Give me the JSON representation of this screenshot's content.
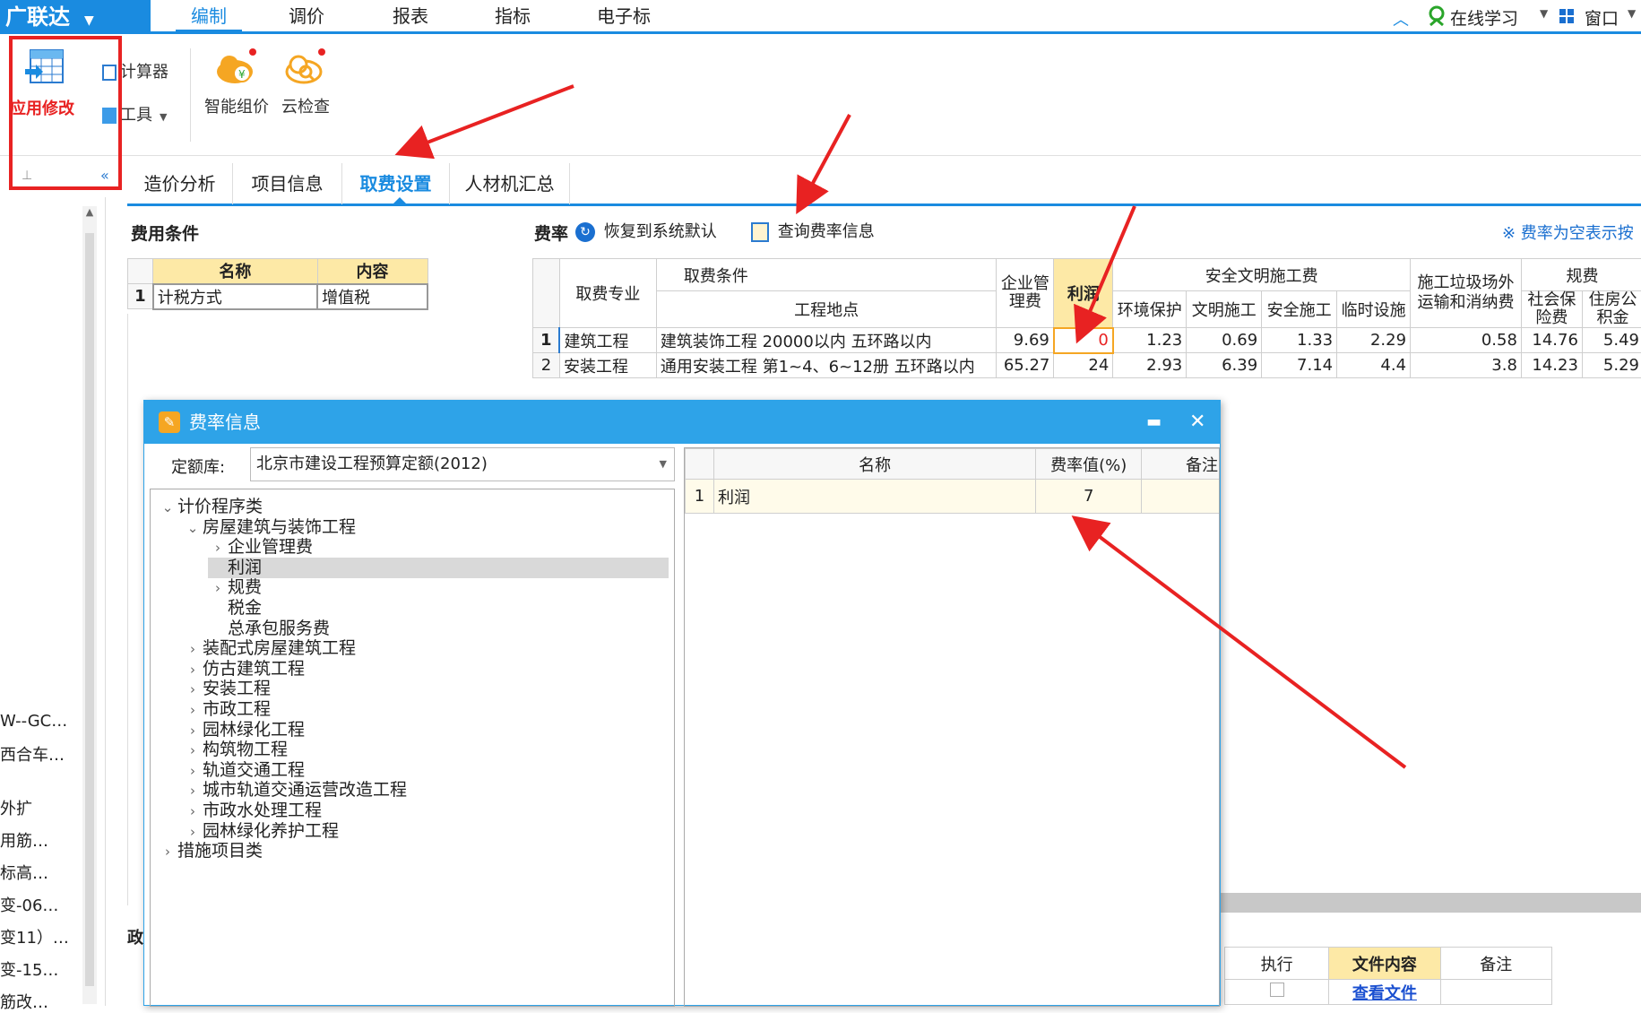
{
  "app": {
    "logo": "广联达",
    "logo_dropdown": "▼"
  },
  "menu": {
    "items": [
      "编制",
      "调价",
      "报表",
      "指标",
      "电子标"
    ],
    "active": "编制",
    "right": {
      "online_learning": "在线学习",
      "window": "窗口"
    }
  },
  "toolbar": {
    "apply_changes": "应用修改",
    "calculator": "计算器",
    "tools": "工具",
    "smart_pricing": "智能组价",
    "cloud_check": "云检查"
  },
  "tabs": [
    "造价分析",
    "项目信息",
    "取费设置",
    "人材机汇总"
  ],
  "active_tab": "取费设置",
  "fee_conditions": {
    "title": "费用条件",
    "headers": [
      "名称",
      "内容"
    ],
    "rows": [
      {
        "num": "1",
        "name": "计税方式",
        "content": "增值税"
      }
    ]
  },
  "rates": {
    "title": "费率",
    "restore_default": "恢复到系统默认",
    "query_rate_info": "查询费率信息",
    "note": "※ 费率为空表示按",
    "headers": {
      "specialty": "取费专业",
      "condition": "取费条件",
      "location": "工程地点",
      "mgmt": "企业管理费",
      "profit": "利润",
      "safety_group": "安全文明施工费",
      "env": "环境保护",
      "civil": "文明施工",
      "safe": "安全施工",
      "temp": "临时设施",
      "garbage": "施工垃圾场外运输和消纳费",
      "gov_group": "规费",
      "social": "社会保险费",
      "housing": "住房公积金"
    },
    "rows": [
      {
        "num": "1",
        "specialty": "建筑工程",
        "location": "建筑装饰工程 20000以内 五环路以内",
        "mgmt": "9.69",
        "profit": "0",
        "env": "1.23",
        "civil": "0.69",
        "safe": "1.33",
        "temp": "2.29",
        "garbage": "0.58",
        "social": "14.76",
        "housing": "5.49"
      },
      {
        "num": "2",
        "specialty": "安装工程",
        "location": "通用安装工程 第1~4、6~12册 五环路以内",
        "mgmt": "65.27",
        "profit": "24",
        "env": "2.93",
        "civil": "6.39",
        "safe": "7.14",
        "temp": "4.4",
        "garbage": "3.8",
        "social": "14.23",
        "housing": "5.29"
      }
    ]
  },
  "dialog": {
    "title": "费率信息",
    "quota_label": "定额库:",
    "quota_value": "北京市建设工程预算定额(2012)",
    "tree": [
      {
        "level": 0,
        "chevron": "open",
        "label": "计价程序类"
      },
      {
        "level": 1,
        "chevron": "open",
        "label": "房屋建筑与装饰工程"
      },
      {
        "level": 2,
        "chevron": "closed",
        "label": "企业管理费"
      },
      {
        "level": 2,
        "chevron": "none",
        "label": "利润",
        "selected": true
      },
      {
        "level": 2,
        "chevron": "closed",
        "label": "规费"
      },
      {
        "level": 2,
        "chevron": "none",
        "label": "税金"
      },
      {
        "level": 2,
        "chevron": "none",
        "label": "总承包服务费"
      },
      {
        "level": 1,
        "chevron": "closed",
        "label": "装配式房屋建筑工程"
      },
      {
        "level": 1,
        "chevron": "closed",
        "label": "仿古建筑工程"
      },
      {
        "level": 1,
        "chevron": "closed",
        "label": "安装工程"
      },
      {
        "level": 1,
        "chevron": "closed",
        "label": "市政工程"
      },
      {
        "level": 1,
        "chevron": "closed",
        "label": "园林绿化工程"
      },
      {
        "level": 1,
        "chevron": "closed",
        "label": "构筑物工程"
      },
      {
        "level": 1,
        "chevron": "closed",
        "label": "轨道交通工程"
      },
      {
        "level": 1,
        "chevron": "closed",
        "label": "城市轨道交通运营改造工程"
      },
      {
        "level": 1,
        "chevron": "closed",
        "label": "市政水处理工程"
      },
      {
        "level": 1,
        "chevron": "closed",
        "label": "园林绿化养护工程"
      },
      {
        "level": 0,
        "chevron": "closed",
        "label": "措施项目类"
      }
    ],
    "table": {
      "headers": [
        "名称",
        "费率值(%)",
        "备注"
      ],
      "rows": [
        {
          "num": "1",
          "name": "利润",
          "value": "7",
          "note": ""
        }
      ]
    }
  },
  "sidebar_items": [
    "W--GC…",
    "西合车…",
    "外扩",
    "用筋…",
    "标高…",
    "变-06…",
    "变11）…",
    "变-15…",
    "筋改…"
  ],
  "bottom_table": {
    "headers": [
      "执行",
      "文件内容",
      "备注"
    ],
    "link": "查看文件"
  },
  "left_partial": "政"
}
